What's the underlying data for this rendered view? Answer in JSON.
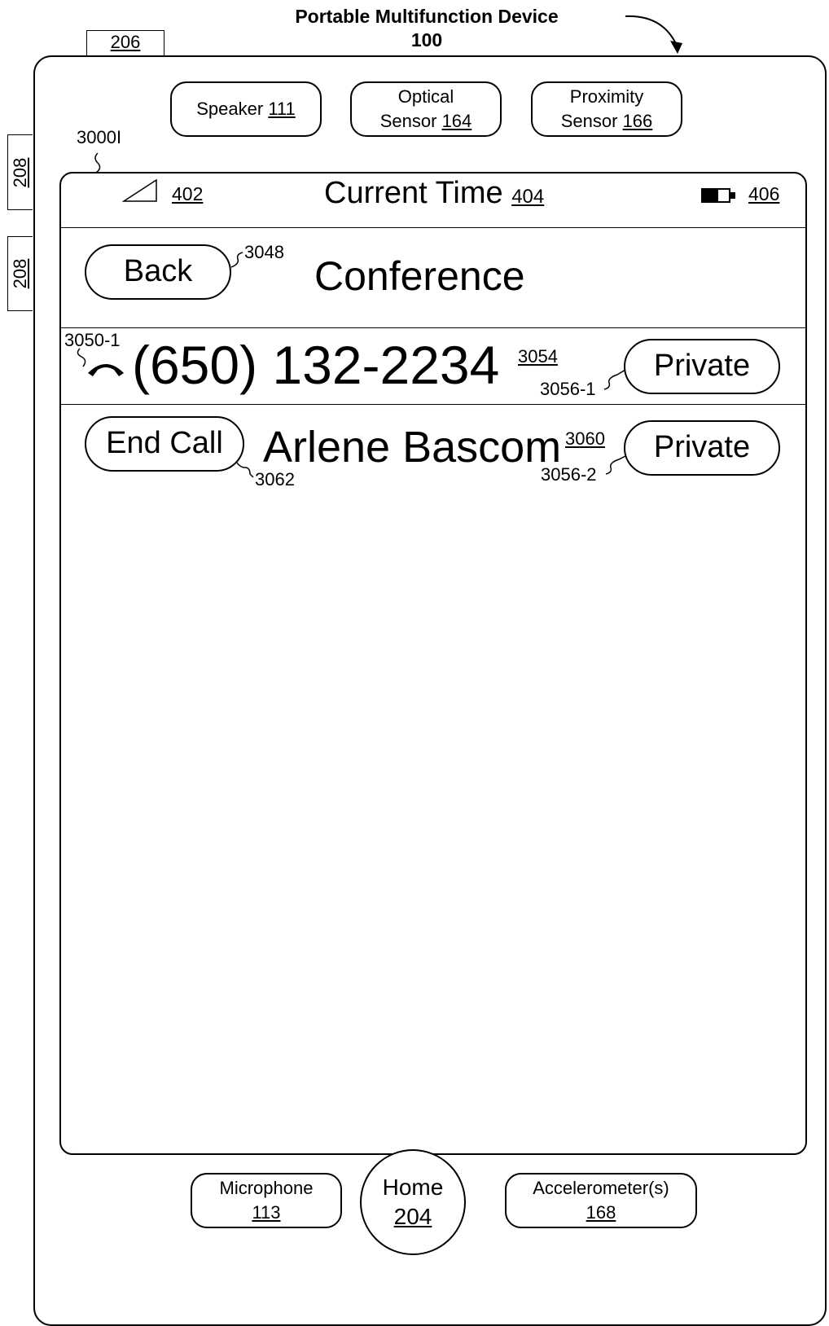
{
  "header": {
    "title": "Portable Multifunction Device",
    "number": "100"
  },
  "refs": {
    "top_button": "206",
    "side_button_1": "208",
    "side_button_2": "208",
    "screen": "3000I",
    "signal": "402",
    "battery": "406",
    "back_button": "3048",
    "call_icon": "3050-1",
    "phone_number": "3054",
    "private_1": "3056-1",
    "contact": "3060",
    "private_2": "3056-2",
    "end_call": "3062"
  },
  "sensors": {
    "speaker": {
      "label": "Speaker",
      "ref": "111"
    },
    "optical": {
      "line1": "Optical",
      "line2": "Sensor",
      "ref": "164"
    },
    "proximity": {
      "line1": "Proximity",
      "line2": "Sensor",
      "ref": "166"
    }
  },
  "status_bar": {
    "time_label": "Current Time",
    "time_ref": "404"
  },
  "nav": {
    "back_label": "Back",
    "title": "Conference"
  },
  "calls": [
    {
      "caller": "(650) 132-2234",
      "button": "Private"
    },
    {
      "end_label": "End Call",
      "caller": "Arlene Bascom",
      "button": "Private"
    }
  ],
  "bottom": {
    "microphone": {
      "label": "Microphone",
      "ref": "113"
    },
    "home": {
      "label": "Home",
      "ref": "204"
    },
    "accelerometer": {
      "label": "Accelerometer(s)",
      "ref": "168"
    }
  }
}
